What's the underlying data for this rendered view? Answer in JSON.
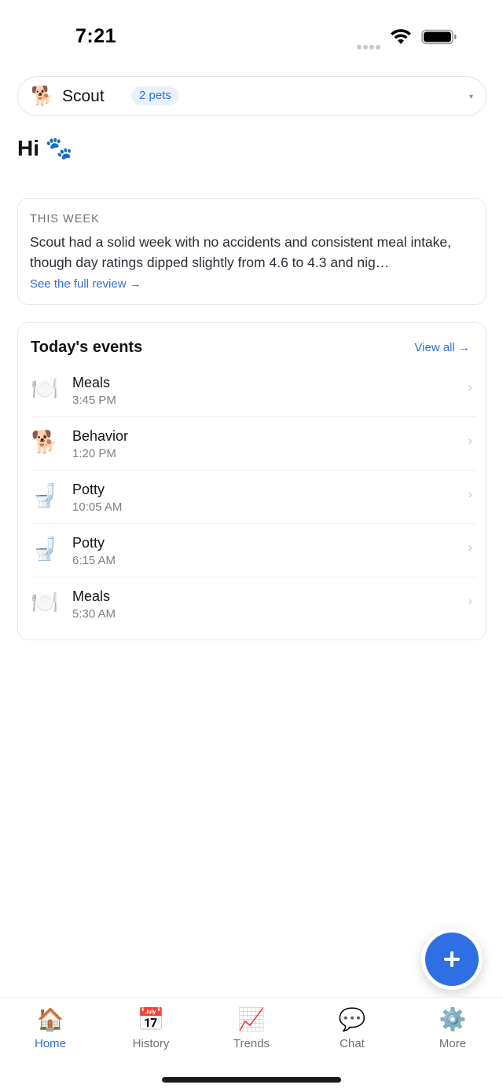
{
  "status_bar": {
    "time": "7:21"
  },
  "pet_selector": {
    "avatar": "🐕",
    "name": "Scout",
    "count": "2 pets",
    "dropdown": "▾"
  },
  "greeting": "Hi 🐾",
  "week_card": {
    "label": "THIS WEEK",
    "summary": "Scout had a solid week with no accidents and consistent meal intake, though day ratings dipped slightly from 4.6 to 4.3 and nig…",
    "link": "See the full review →"
  },
  "events": {
    "title": "Today's events",
    "view_all": "View all →",
    "items": [
      {
        "icon": "🍽️",
        "name": "Meals",
        "time": "3:45 PM"
      },
      {
        "icon": "🐕",
        "name": "Behavior",
        "time": "1:20 PM"
      },
      {
        "icon": "🚽",
        "name": "Potty",
        "time": "10:05 AM"
      },
      {
        "icon": "🚽",
        "name": "Potty",
        "time": "6:15 AM"
      },
      {
        "icon": "🍽️",
        "name": "Meals",
        "time": "5:30 AM"
      }
    ]
  },
  "tabs": [
    {
      "icon": "🏠",
      "label": "Home"
    },
    {
      "icon": "📅",
      "label": "History"
    },
    {
      "icon": "📈",
      "label": "Trends"
    },
    {
      "icon": "💬",
      "label": "Chat"
    },
    {
      "icon": "⚙️",
      "label": "More"
    }
  ],
  "colors": {
    "accent": "#2f6fdc",
    "fab": "#2f6fe4"
  }
}
